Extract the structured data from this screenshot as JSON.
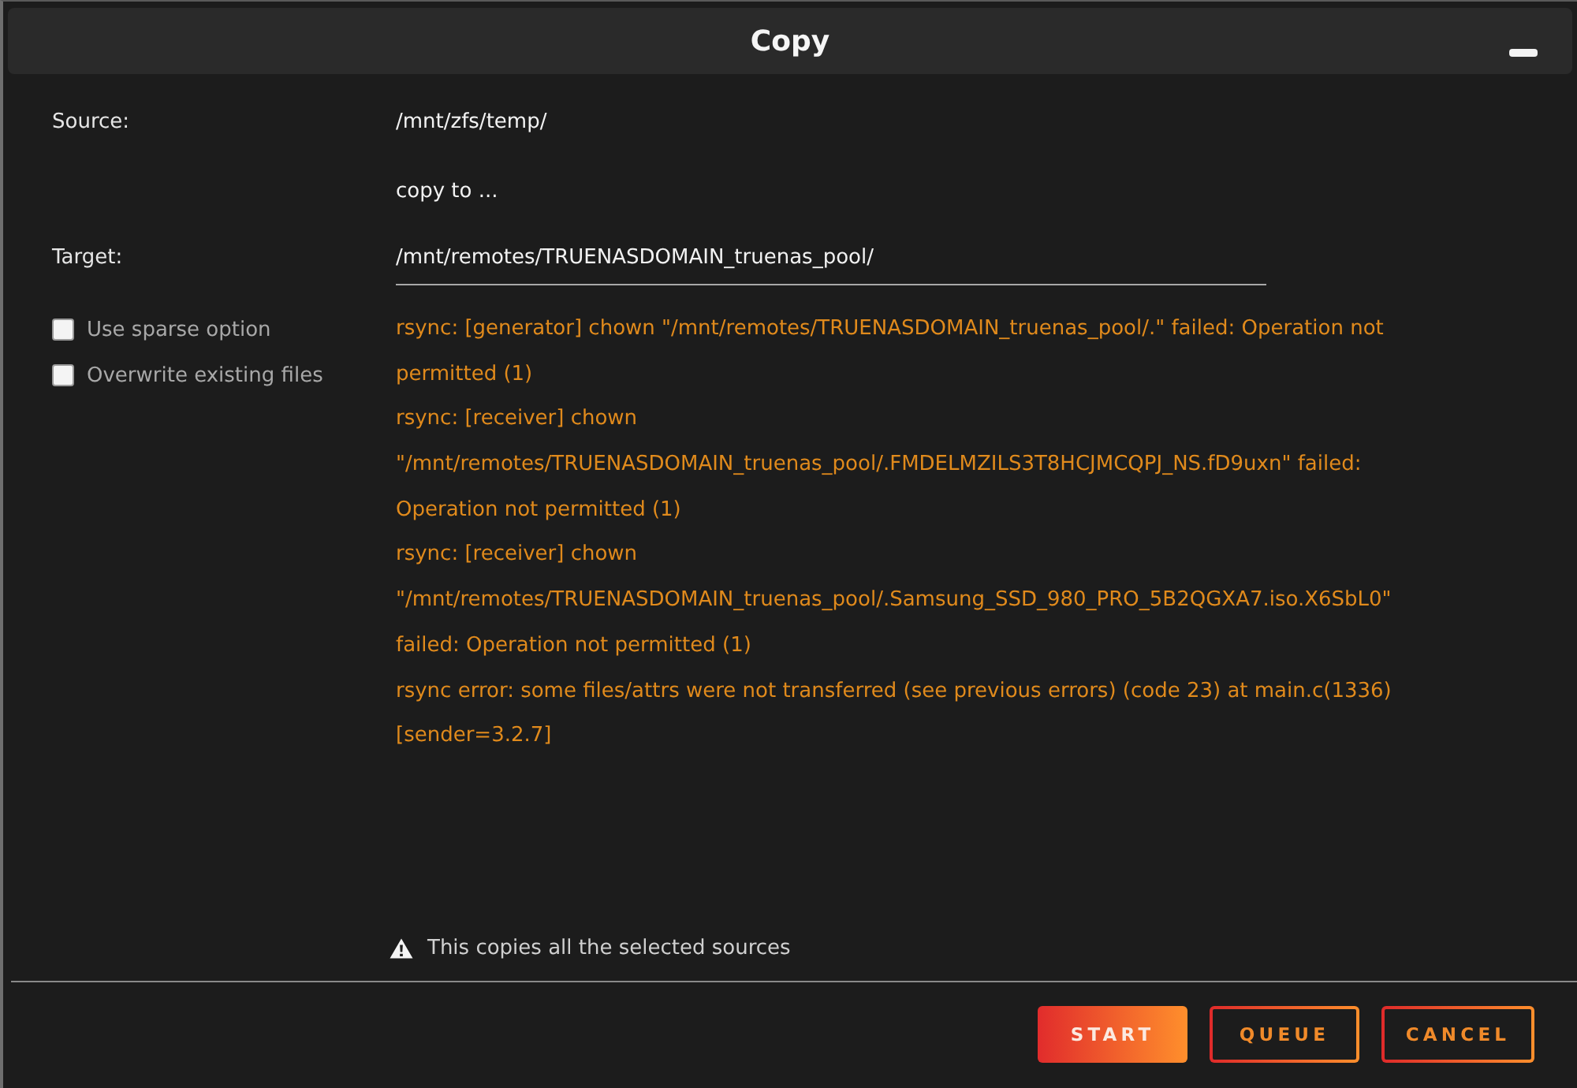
{
  "window": {
    "title": "Copy"
  },
  "form": {
    "source": {
      "label": "Source:",
      "value": "/mnt/zfs/temp/"
    },
    "connector": "copy to ...",
    "target": {
      "label": "Target:",
      "value": "/mnt/remotes/TRUENASDOMAIN_truenas_pool/"
    }
  },
  "options": [
    {
      "label": "Use sparse option",
      "checked": false
    },
    {
      "label": "Overwrite existing files",
      "checked": false
    }
  ],
  "log_lines": [
    "rsync: [generator] chown \"/mnt/remotes/TRUENASDOMAIN_truenas_pool/.\" failed: Operation not",
    "permitted (1)",
    "rsync: [receiver] chown",
    "\"/mnt/remotes/TRUENASDOMAIN_truenas_pool/.FMDELMZILS3T8HCJMCQPJ_NS.fD9uxn\" failed:",
    "Operation not permitted (1)",
    "rsync: [receiver] chown",
    "\"/mnt/remotes/TRUENASDOMAIN_truenas_pool/.Samsung_SSD_980_PRO_5B2QGXA7.iso.X6SbL0\"",
    "failed: Operation not permitted (1)",
    "rsync error: some files/attrs were not transferred (see previous errors) (code 23) at main.c(1336)",
    "[sender=3.2.7]"
  ],
  "warning": "This copies all the selected sources",
  "buttons": [
    {
      "label": "START",
      "kind": "primary"
    },
    {
      "label": "QUEUE",
      "kind": "outline"
    },
    {
      "label": "CANCEL",
      "kind": "outline"
    }
  ]
}
